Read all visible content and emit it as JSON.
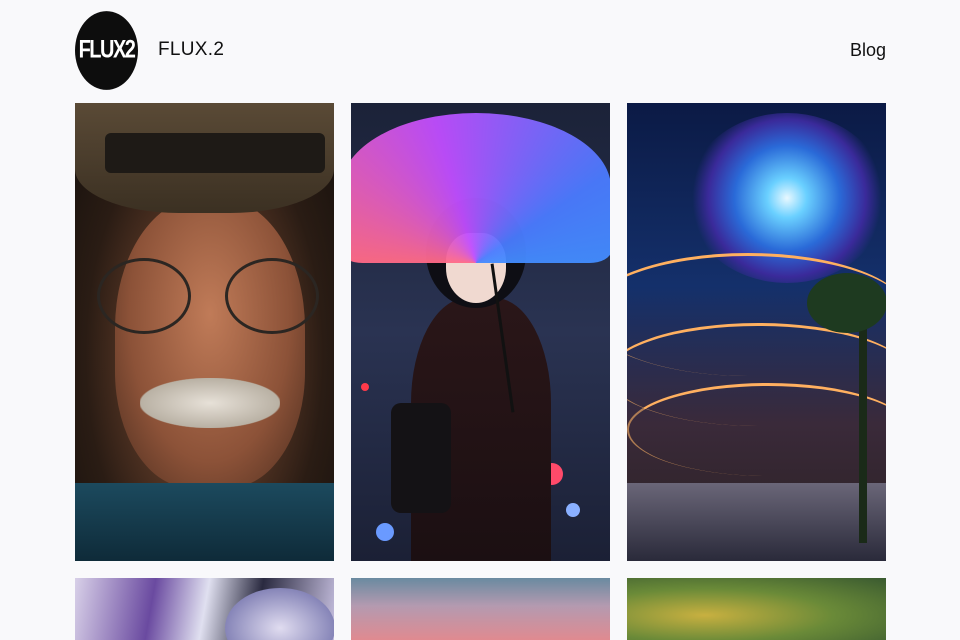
{
  "header": {
    "logo_text": "FLUX2",
    "brand_name": "FLUX.2",
    "nav_link": "Blog"
  },
  "gallery": {
    "tiles": [
      {
        "subject": "elderly man with round glasses and hat"
      },
      {
        "subject": "anime girl with neon umbrella"
      },
      {
        "subject": "futuristic mall with galaxy skylight"
      },
      {
        "subject": "chrome robot"
      },
      {
        "subject": "dusk gradient sky"
      },
      {
        "subject": "blurred green and gold"
      }
    ]
  }
}
